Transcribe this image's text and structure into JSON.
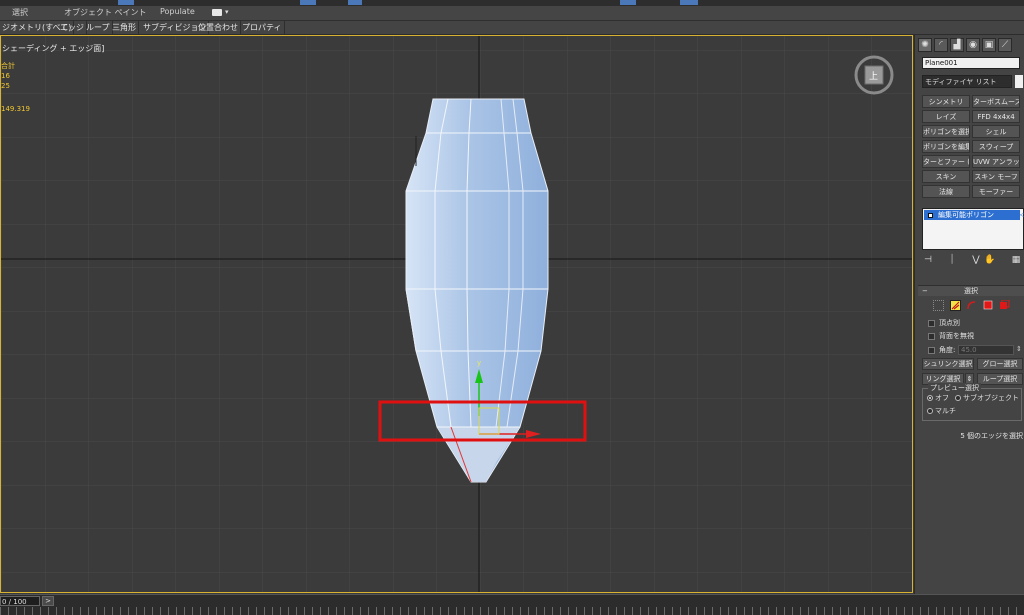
{
  "ribbon": {
    "tabs": [
      "選択",
      "オブジェクト ペイント",
      "Populate"
    ]
  },
  "subtoolbar": {
    "items": [
      "ジオメトリ(すべて)",
      "エッジ",
      "ループ",
      "三角形",
      "サブディビジョン",
      "位置合わせ",
      "プロパティ"
    ]
  },
  "viewport": {
    "label": "シェーディング + エッジ面]",
    "stats": [
      "合計",
      "16",
      "25",
      "149.319"
    ],
    "viewcube_face": "上",
    "highlight_color": "#e01010",
    "active_border_color": "#d8b233"
  },
  "command_panel": {
    "tab_icons": [
      "create-icon",
      "modify-icon",
      "hierarchy-icon",
      "motion-icon",
      "display-icon",
      "utilities-icon"
    ],
    "object_name": "Plane001",
    "modifier_list_label": "モディファイヤ リスト",
    "modifier_buttons": [
      [
        "シンメトリ",
        "ターボスムーズ"
      ],
      [
        "レイズ",
        "FFD 4x4x4"
      ],
      [
        "ポリゴンを選択",
        "シェル"
      ],
      [
        "ポリゴンを編集",
        "スウィープ"
      ],
      [
        "ターとファー (WS",
        "UVW アンラップ"
      ],
      [
        "スキン",
        "スキン モーフ"
      ],
      [
        "法線",
        "モーファー"
      ]
    ],
    "stack_item": "編集可能ポリゴン",
    "rollout": {
      "title": "選択",
      "collapse_symbol": "−",
      "by_vertex": "頂点別",
      "ignore_backfacing": "背面を無視",
      "angle_label": "角度:",
      "angle_value": "45.0",
      "shrink": "シュリンク選択",
      "grow": "グロー選択",
      "ring": "リング選択",
      "loop": "ループ選択",
      "preview_group": "プレビュー選択",
      "preview_off": "オフ",
      "preview_subobject": "サブオブジェクト",
      "preview_multi": "マルチ",
      "status": "5 個のエッジを選択"
    }
  },
  "timeline": {
    "frame": "0 / 100",
    "next": ">"
  }
}
